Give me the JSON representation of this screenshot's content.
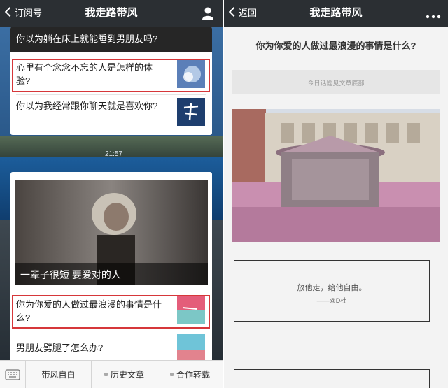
{
  "left": {
    "navbar": {
      "back_label": "订阅号",
      "title": "我走路带风",
      "right_icon": "person-icon"
    },
    "top_card": {
      "row1": "你以为躺在床上就能睡到男朋友吗?",
      "row2": "心里有个念念不忘的人是怎样的体验?",
      "row3": "你以为我经常跟你聊天就是喜欢你?"
    },
    "background_time": "21:57",
    "second_card": {
      "cover_caption": "一辈子很短 要爱对的人",
      "row1": "你为你爱的人做过最浪漫的事情是什么?",
      "row2": "男朋友劈腿了怎么办?"
    },
    "bottom_bar": {
      "keyboard_icon": "keyboard-icon",
      "items": [
        "带风自白",
        "历史文章",
        "合作转载"
      ]
    }
  },
  "right": {
    "navbar": {
      "back_label": "返回",
      "title": "我走路带风",
      "right_icon": "more-icon"
    },
    "article_title": "你为你爱的人做过最浪漫的事情是什么?",
    "note": "今日话题见文章底部",
    "quote": "放他走，给他自由。",
    "quote_author": "——@D杜"
  },
  "colors": {
    "navbar": "#2b2f33",
    "highlight": "#d6373a",
    "photo_tint": "#c98fb0"
  }
}
